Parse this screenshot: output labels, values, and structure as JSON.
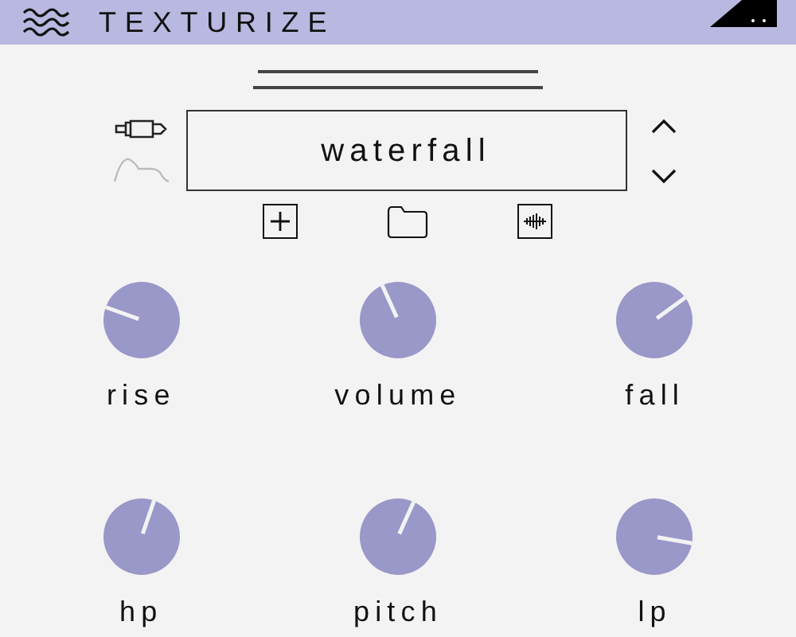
{
  "header": {
    "title": "TEXTURIZE"
  },
  "preset": {
    "name": "waterfall"
  },
  "knobs": [
    {
      "label": "rise"
    },
    {
      "label": "volume"
    },
    {
      "label": "fall"
    },
    {
      "label": "hp"
    },
    {
      "label": "pitch"
    },
    {
      "label": "lp"
    }
  ]
}
